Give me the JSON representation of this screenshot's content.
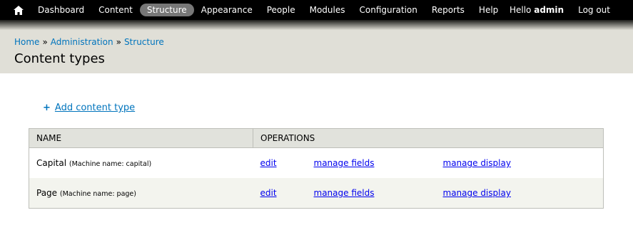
{
  "toolbar": {
    "menu": [
      "Dashboard",
      "Content",
      "Structure",
      "Appearance",
      "People",
      "Modules",
      "Configuration",
      "Reports",
      "Help"
    ],
    "active": "Structure",
    "hello_prefix": "Hello",
    "user": "admin",
    "logout": "Log out"
  },
  "header": {
    "breadcrumb": [
      "Home",
      "Administration",
      "Structure"
    ],
    "breadcrumb_separator": "»",
    "title": "Content types"
  },
  "actions": {
    "add_icon": "+",
    "add_label": "Add content type"
  },
  "table": {
    "headers": {
      "name": "NAME",
      "operations": "OPERATIONS"
    },
    "rows": [
      {
        "name": "Capital",
        "machine": "(Machine name: capital)",
        "ops": [
          "edit",
          "manage fields",
          "manage display"
        ]
      },
      {
        "name": "Page",
        "machine": "(Machine name: page)",
        "ops": [
          "edit",
          "manage fields",
          "manage display"
        ]
      }
    ]
  },
  "colors": {
    "link": "#0074bd",
    "toolbar_bg": "#000000",
    "header_bg": "#e0dfd7",
    "active_pill": "#777777"
  }
}
